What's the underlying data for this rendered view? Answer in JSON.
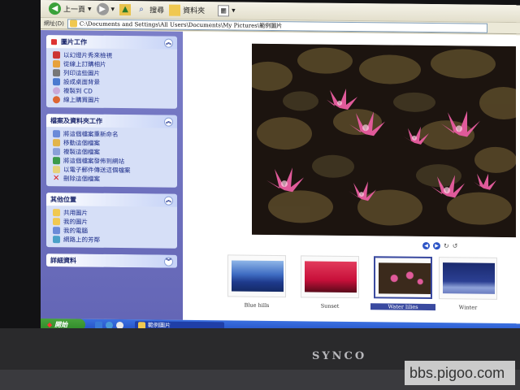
{
  "toolbar": {
    "back_label": "上一頁",
    "search_label": "搜尋",
    "folders_label": "資料夾"
  },
  "address": {
    "label": "網址(D)",
    "path": "C:\\Documents and Settings\\All Users\\Documents\\My Pictures\\範例圖片"
  },
  "pane": {
    "picture_tasks": {
      "title": "圖片工作",
      "items": [
        "以幻燈片秀來檢視",
        "從線上訂購相片",
        "列印這些圖片",
        "設成桌面背景",
        "複製到 CD",
        "線上購買圖片"
      ]
    },
    "file_tasks": {
      "title": "檔案及資料夾工作",
      "items": [
        "將這個檔案重新命名",
        "移動這個檔案",
        "複製這個檔案",
        "將這個檔案發佈到網站",
        "以電子郵件傳送這個檔案",
        "刪除這個檔案"
      ]
    },
    "other_places": {
      "title": "其他位置",
      "items": [
        "共用圖片",
        "我的圖片",
        "我的電腦",
        "網路上的芳鄰"
      ]
    },
    "details": {
      "title": "詳細資料"
    }
  },
  "thumbnails": [
    {
      "label": "Blue hills",
      "selected": false
    },
    {
      "label": "Sunset",
      "selected": false
    },
    {
      "label": "Water lilies",
      "selected": true
    },
    {
      "label": "Winter",
      "selected": false
    }
  ],
  "taskbar": {
    "start_label": "開始",
    "task_label": "範例圖片"
  },
  "monitor": {
    "brand": "SYNCO"
  },
  "watermark": "bbs.pigoo.com"
}
